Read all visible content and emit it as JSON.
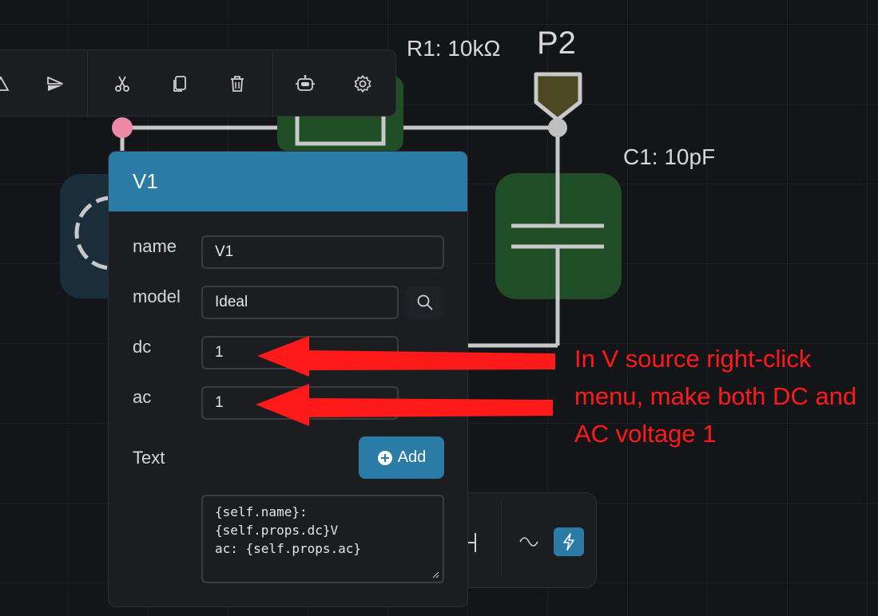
{
  "toolbar": {
    "icons": [
      "triangle-icon",
      "flip-icon",
      "cut-icon",
      "copy-icon",
      "delete-icon",
      "robot-icon",
      "gear-icon"
    ]
  },
  "canvas": {
    "r1_label": "R1: 10kΩ",
    "p2_label": "P2",
    "c1_label": "C1: 10pF",
    "colors": {
      "wire": "#c8c8c8",
      "component_fill": "#1f4d26",
      "source_fill": "#1b2f3a",
      "port_fill": "#4d4822",
      "node_pink": "#ee8aa6"
    }
  },
  "dialog": {
    "title": "V1",
    "fields": [
      {
        "label": "name",
        "value": "V1"
      },
      {
        "label": "model",
        "value": "Ideal"
      },
      {
        "label": "dc",
        "value": "1"
      },
      {
        "label": "ac",
        "value": "1"
      }
    ],
    "text_label": "Text",
    "add_label": "Add",
    "text_template": "{self.name}:\n{self.props.dc}V\nac: {self.props.ac}",
    "accent": "#2a7ba6"
  },
  "annotation": {
    "text": "In V source right-click menu, make both DC and AC voltage 1",
    "color": "#ff1a1a"
  }
}
